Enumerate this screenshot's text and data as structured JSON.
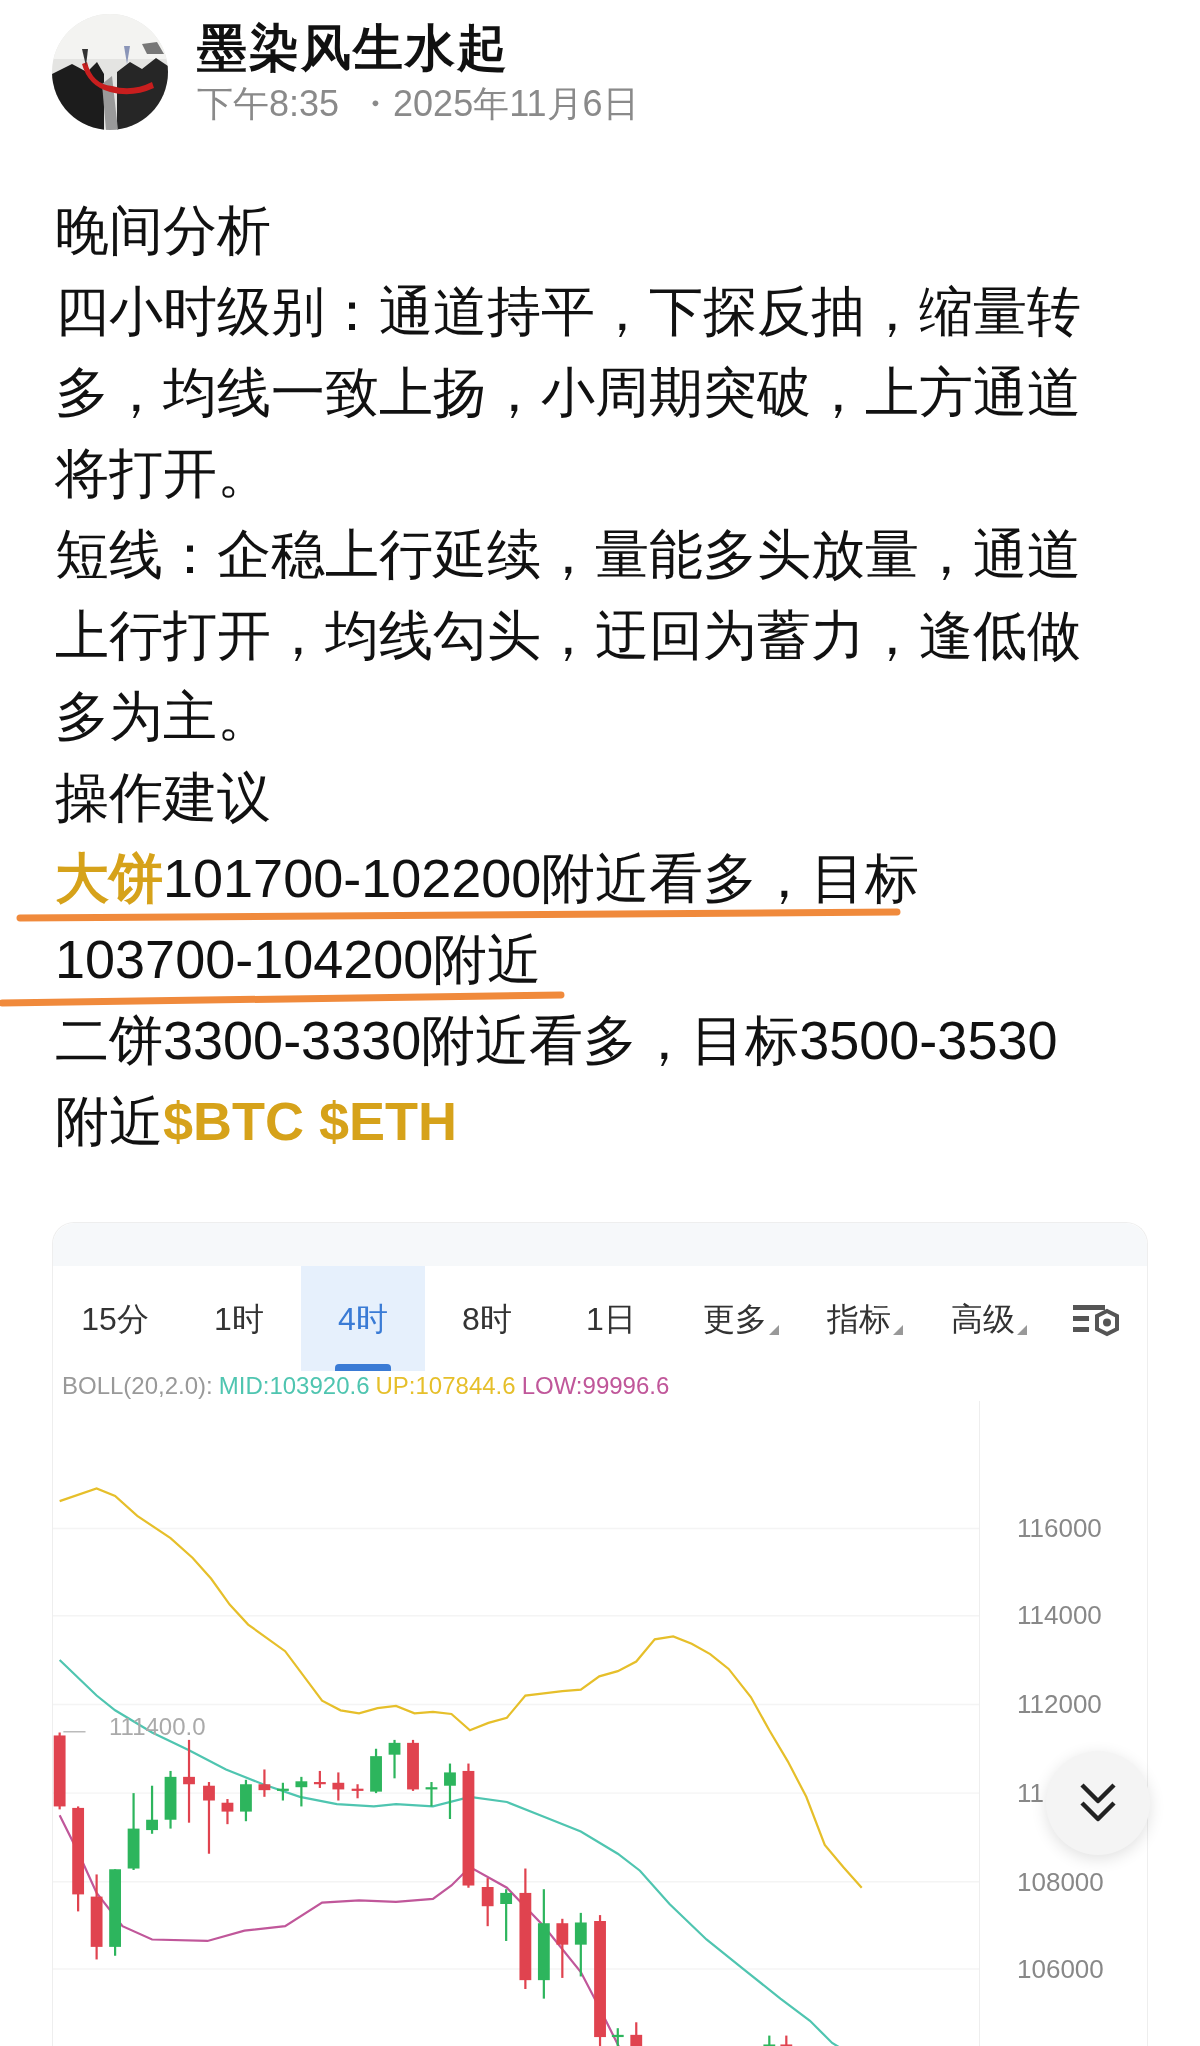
{
  "author": {
    "name": "墨染风生水起",
    "time": "下午8:35",
    "date": "・2025年11月6日"
  },
  "paragraphs": [
    {
      "text": "晚间分析",
      "underlined": false
    },
    {
      "text": "四小时级别：通道持平，下探反抽，缩量转多，均线一致上扬，小周期突破，上方通道将打开。",
      "underlined": false
    },
    {
      "text": "短线：企稳上行延续，量能多头放量，通道上行打开，均线勾头，迂回为蓄力，逢低做多为主。",
      "underlined": false
    },
    {
      "text": "操作建议",
      "underlined": false
    },
    {
      "text": "**大饼**101700-102200附近看多，目标103700-104200附近",
      "underlined": true
    },
    {
      "text": "二饼3300-3330附近看多，目标3500-3530附近**$BTC $ETH**",
      "underlined": false
    }
  ],
  "chart": {
    "tabs": [
      {
        "label": "15分",
        "selected": false,
        "dropdown": false
      },
      {
        "label": "1时",
        "selected": false,
        "dropdown": false
      },
      {
        "label": "4时",
        "selected": true,
        "dropdown": false
      },
      {
        "label": "8时",
        "selected": false,
        "dropdown": false
      },
      {
        "label": "1日",
        "selected": false,
        "dropdown": false
      },
      {
        "label": "更多",
        "selected": false,
        "dropdown": true
      },
      {
        "label": "指标",
        "selected": false,
        "dropdown": true
      },
      {
        "label": "高级",
        "selected": false,
        "dropdown": true
      }
    ],
    "indicator": {
      "name": "BOLL(20,2.0):",
      "mid": "MID:103920.6",
      "up": "UP:107844.6",
      "low": "LOW:99996.6"
    },
    "price_line_label": "111400.0",
    "y_axis_labels": [
      "116000",
      "114000",
      "112000",
      "11",
      "108000",
      "106000"
    ]
  }
}
